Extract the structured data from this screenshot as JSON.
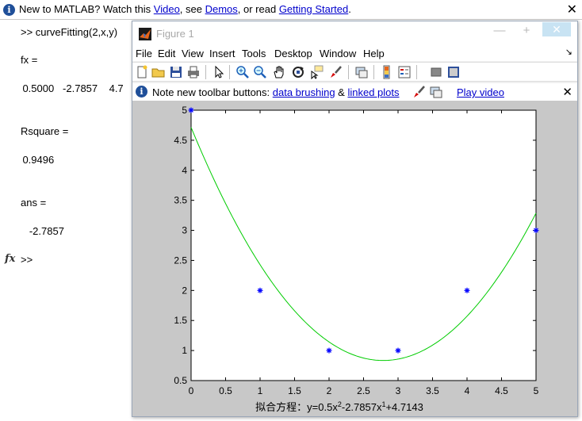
{
  "banner": {
    "prefix": "New to MATLAB? Watch this ",
    "video_link": "Video",
    "mid": ", see ",
    "demos_link": "Demos",
    "mid2": ", or read ",
    "getting_started_link": "Getting Started",
    "suffix": ".",
    "close": "✕"
  },
  "command_window": {
    "lines": [
      ">> curveFitting(2,x,y)",
      "fx =",
      "    0.5000   -2.7857    4.7",
      "Rsquare =",
      "    0.9496",
      "ans =",
      "   -2.7857",
      ">>"
    ],
    "fx_icon": "fx"
  },
  "figure": {
    "title": "Figure 1",
    "min": "—",
    "max": "+",
    "close": "✕",
    "menu": [
      "File",
      "Edit",
      "View",
      "Insert",
      "Tools",
      "Desktop",
      "Window",
      "Help"
    ],
    "menu_arrow": "↘",
    "notice": {
      "prefix": "Note new toolbar buttons: ",
      "link1": "data brushing",
      "amp": " & ",
      "link2": "linked plots",
      "play": "Play video",
      "close": "✕"
    },
    "toolbar_icons": [
      "new-figure-icon",
      "open-file-icon",
      "save-icon",
      "print-icon",
      "pointer-icon",
      "zoom-in-icon",
      "zoom-out-icon",
      "pan-icon",
      "rotate-icon",
      "data-cursor-icon",
      "brush-icon",
      "link-icon",
      "colorbar-icon",
      "legend-icon",
      "hide-plot-tools-icon",
      "show-plot-tools-icon"
    ]
  },
  "chart_data": {
    "type": "scatter",
    "title": "",
    "xlabel": "拟合方程：y=0.5x²-2.7857x¹+4.7143",
    "xlabel_parts": {
      "a": "拟合方程：y=0.5x",
      "s1": "2",
      "b": "-2.7857x",
      "s2": "1",
      "c": "+4.7143"
    },
    "ylabel": "",
    "xlim": [
      0,
      5
    ],
    "ylim": [
      0.5,
      5
    ],
    "xticks": [
      "0",
      "0.5",
      "1",
      "1.5",
      "2",
      "2.5",
      "3",
      "3.5",
      "4",
      "4.5",
      "5"
    ],
    "yticks": [
      "0.5",
      "1",
      "1.5",
      "2",
      "2.5",
      "3",
      "3.5",
      "4",
      "4.5",
      "5"
    ],
    "series": [
      {
        "kind": "points",
        "marker": "*",
        "color": "#0000ff",
        "x": [
          0,
          1,
          2,
          3,
          4,
          5
        ],
        "y": [
          5,
          2,
          1,
          1,
          2,
          3
        ]
      },
      {
        "kind": "curve",
        "color": "#00cc00",
        "coefficients": [
          0.5,
          -2.7857,
          4.7143
        ]
      }
    ],
    "grid": false
  }
}
